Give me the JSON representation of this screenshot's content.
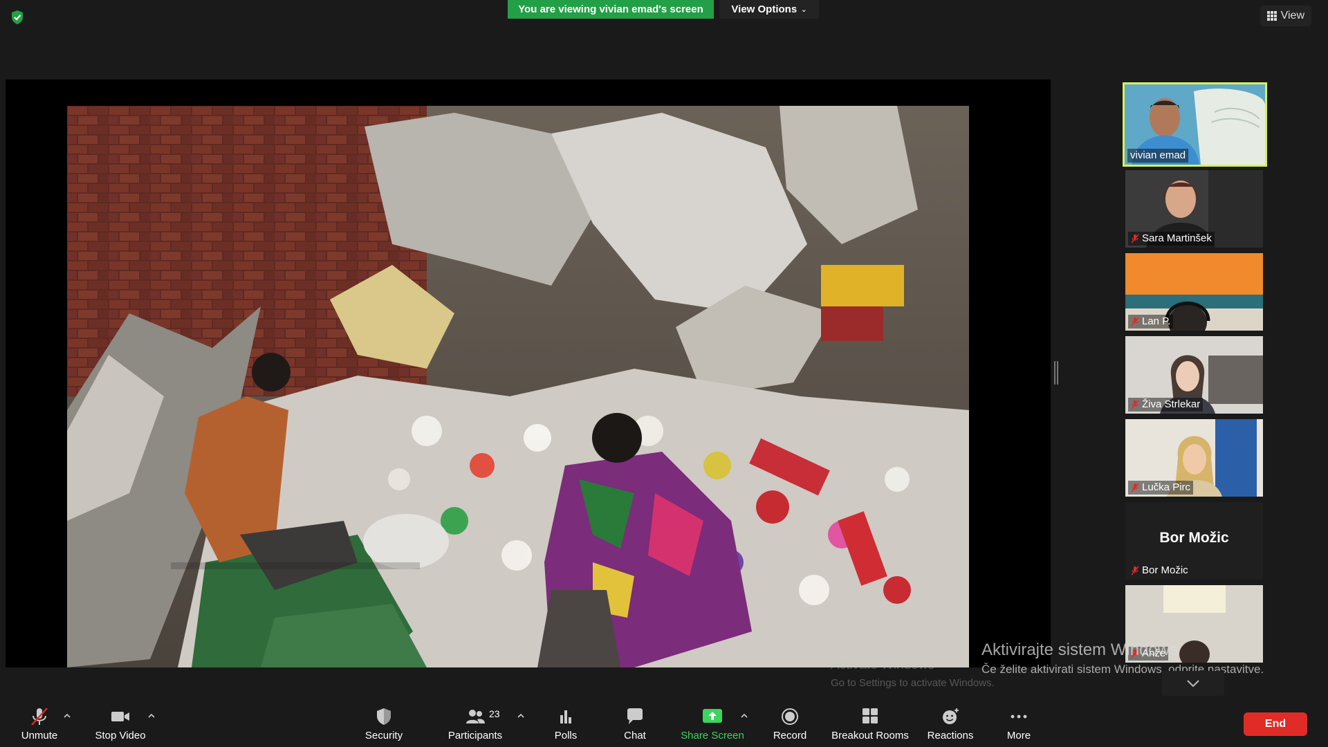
{
  "top_bar": {
    "viewing_banner": "You are viewing vivian emad's screen",
    "view_options": "View Options",
    "view_button": "View"
  },
  "gallery": [
    {
      "name": "vivian emad",
      "muted": false,
      "active": true
    },
    {
      "name": "Sara Martinšek",
      "muted": true,
      "active": false
    },
    {
      "name": "Lan P.",
      "muted": true,
      "active": false
    },
    {
      "name": "Živa Strlekar",
      "muted": true,
      "active": false
    },
    {
      "name": "Lučka Pirc",
      "muted": true,
      "active": false
    },
    {
      "name": "Bor Možic",
      "muted": true,
      "active": false,
      "no_video": true,
      "display_name": "Bor Možic"
    },
    {
      "name": "Anže",
      "muted": true,
      "active": false
    }
  ],
  "watermark": {
    "shared_line1": "Activate Windows",
    "shared_line2": "Go to Settings to activate Windows.",
    "line1": "Aktivirajte sistem Windows",
    "line2": "Če želite aktivirati sistem Windows, odprite nastavitve."
  },
  "toolbar": {
    "unmute": "Unmute",
    "stop_video": "Stop Video",
    "security": "Security",
    "participants": "Participants",
    "participants_count": "23",
    "polls": "Polls",
    "chat": "Chat",
    "share_screen": "Share Screen",
    "record": "Record",
    "breakout_rooms": "Breakout Rooms",
    "reactions": "Reactions",
    "more": "More",
    "end": "End"
  },
  "colors": {
    "banner_green": "#23a047",
    "active_speaker_border": "#d6f05a",
    "share_green": "#3bd45e",
    "end_red": "#e02b27"
  }
}
